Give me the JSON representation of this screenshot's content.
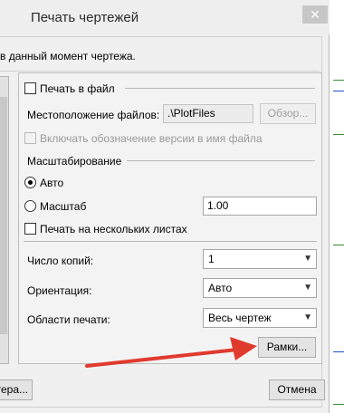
{
  "dialog": {
    "title": "Печать чертежей",
    "close_glyph": "✕",
    "description": "в данный момент чертежа."
  },
  "print_to_file": {
    "label": "Печать в файл",
    "checked": false
  },
  "file_location": {
    "label": "Местоположение файлов:",
    "value": ".\\PlotFiles",
    "browse_label": "Обзор..."
  },
  "version_option": {
    "label": "Включать обозначение версии в имя файла",
    "checked": false,
    "enabled": false
  },
  "scaling": {
    "heading": "Масштабирование",
    "auto_label": "Авто",
    "scale_label": "Масштаб",
    "scale_value": "1.00",
    "selected": "auto"
  },
  "multi_sheet": {
    "label": "Печать на нескольких листах",
    "checked": false
  },
  "copies": {
    "label": "Число копий:",
    "value": "1"
  },
  "orientation": {
    "label": "Ориентация:",
    "value": "Авто"
  },
  "print_area": {
    "label": "Области печати:",
    "value": "Весь чертеж"
  },
  "frames_button": "Рамки...",
  "bottom": {
    "left_button": "тера...",
    "cancel_button": "Отмена"
  },
  "colors": {
    "annotation_arrow": "#e03a2e",
    "dialog_bg": "#f0f0f0"
  },
  "icons": {
    "close": "close-icon",
    "dropdown": "chevron-down-icon"
  }
}
